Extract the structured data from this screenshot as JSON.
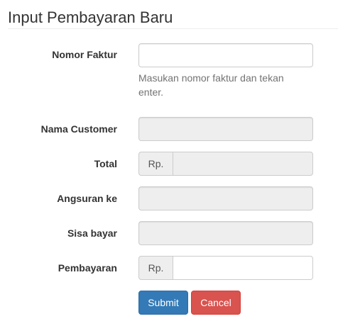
{
  "title": "Input Pembayaran Baru",
  "fields": {
    "nomor_faktur": {
      "label": "Nomor Faktur",
      "value": "",
      "help": "Masukan nomor faktur dan tekan enter."
    },
    "nama_customer": {
      "label": "Nama Customer",
      "value": ""
    },
    "total": {
      "label": "Total",
      "addon": "Rp.",
      "value": ""
    },
    "angsuran": {
      "label": "Angsuran ke",
      "value": ""
    },
    "sisa": {
      "label": "Sisa bayar",
      "value": ""
    },
    "pembayaran": {
      "label": "Pembayaran",
      "addon": "Rp.",
      "value": ""
    }
  },
  "buttons": {
    "submit": "Submit",
    "cancel": "Cancel"
  },
  "colors": {
    "submit": "#337ab7",
    "cancel": "#d9534f"
  }
}
